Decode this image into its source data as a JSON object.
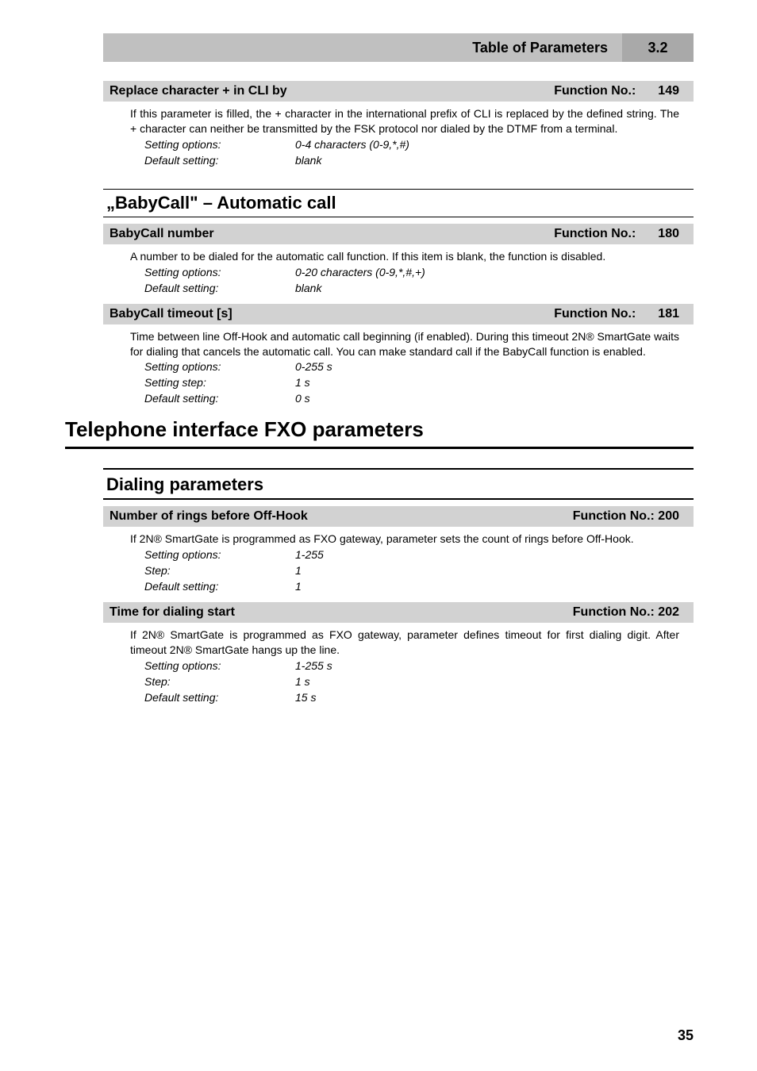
{
  "topbar": {
    "title": "Table of Parameters",
    "section": "3.2"
  },
  "p149": {
    "title": "Replace character + in CLI by",
    "fnlabel": "Function No.:",
    "fnnum": "149",
    "body": "If this parameter is filled, the + character in the international prefix of CLI is replaced by the defined string. The + character can neither be transmitted by the FSK protocol nor dialed by the DTMF from a terminal.",
    "opts_k": "Setting options:",
    "opts_v": "0-4 characters (0-9,*,#)",
    "def_k": "Default setting:",
    "def_v": "blank"
  },
  "babycall_heading": "„BabyCall\" – Automatic call",
  "p180": {
    "title": "BabyCall number",
    "fnlabel": "Function No.:",
    "fnnum": "180",
    "body": "A number to be dialed for the automatic call function. If this item is blank, the function is disabled.",
    "opts_k": "Setting options:",
    "opts_v": "0-20 characters (0-9,*,#,+)",
    "def_k": "Default setting:",
    "def_v": "blank"
  },
  "p181": {
    "title": "BabyCall timeout [s]",
    "fnlabel": "Function No.:",
    "fnnum": "181",
    "body": "Time between line Off-Hook and automatic call beginning (if enabled). During this timeout 2N® SmartGate waits for dialing that cancels the automatic call. You can make standard call if the BabyCall function is enabled.",
    "opts_k": "Setting options:",
    "opts_v": "0-255 s",
    "step_k": "Setting step:",
    "step_v": "1 s",
    "def_k": "Default setting:",
    "def_v": "0 s"
  },
  "fxo_heading": "Telephone interface FXO parameters",
  "dialing_heading": "Dialing parameters",
  "p200": {
    "title": "Number of rings before Off-Hook",
    "fnlabel": "Function No.: 200",
    "body": "If 2N® SmartGate is programmed as FXO gateway, parameter sets the count of rings before Off-Hook.",
    "opts_k": "Setting options:",
    "opts_v": "1-255",
    "step_k": "Step:",
    "step_v": "1",
    "def_k": "Default setting:",
    "def_v": "1"
  },
  "p202": {
    "title": "Time for dialing start",
    "fnlabel": "Function No.: 202",
    "body": "If 2N® SmartGate is programmed as FXO gateway, parameter defines timeout for first dialing digit. After timeout 2N® SmartGate hangs up the line.",
    "opts_k": "Setting options:",
    "opts_v": "1-255 s",
    "step_k": "Step:",
    "step_v": "1 s",
    "def_k": "Default setting:",
    "def_v": "15 s"
  },
  "pagenum": "35"
}
